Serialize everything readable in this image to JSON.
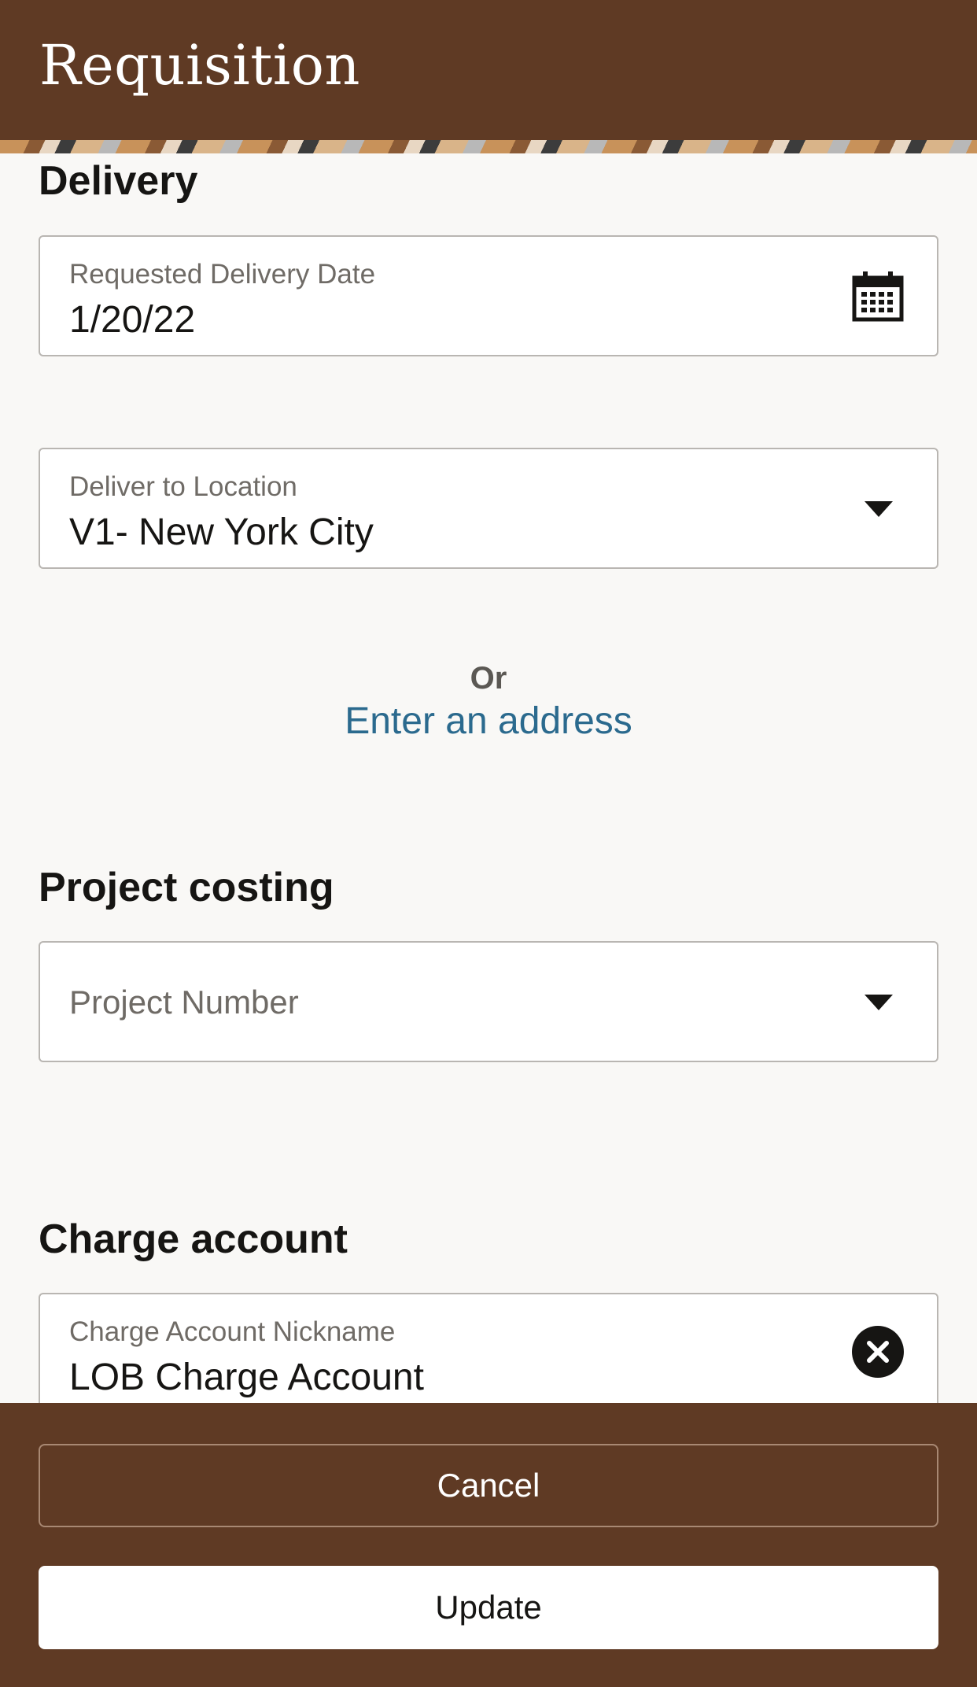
{
  "header": {
    "title": "Requisition"
  },
  "delivery": {
    "section_title": "Delivery",
    "date_field": {
      "label": "Requested Delivery Date",
      "value": "1/20/22"
    },
    "location_field": {
      "label": "Deliver to Location",
      "value": "V1- New York City"
    },
    "or_text": "Or",
    "address_link": "Enter an address"
  },
  "project_costing": {
    "section_title": "Project costing",
    "project_field": {
      "placeholder": "Project Number"
    }
  },
  "charge_account": {
    "section_title": "Charge account",
    "nickname_field": {
      "label": "Charge Account Nickname",
      "value": "LOB Charge Account"
    }
  },
  "footer": {
    "cancel_label": "Cancel",
    "update_label": "Update"
  },
  "icons": {
    "date_field": "calendar-icon",
    "dropdown": "caret-down-icon",
    "clear": "clear-icon"
  },
  "colors": {
    "brand": "#5f3a24",
    "link": "#2b6a8e",
    "background": "#f9f8f6"
  }
}
